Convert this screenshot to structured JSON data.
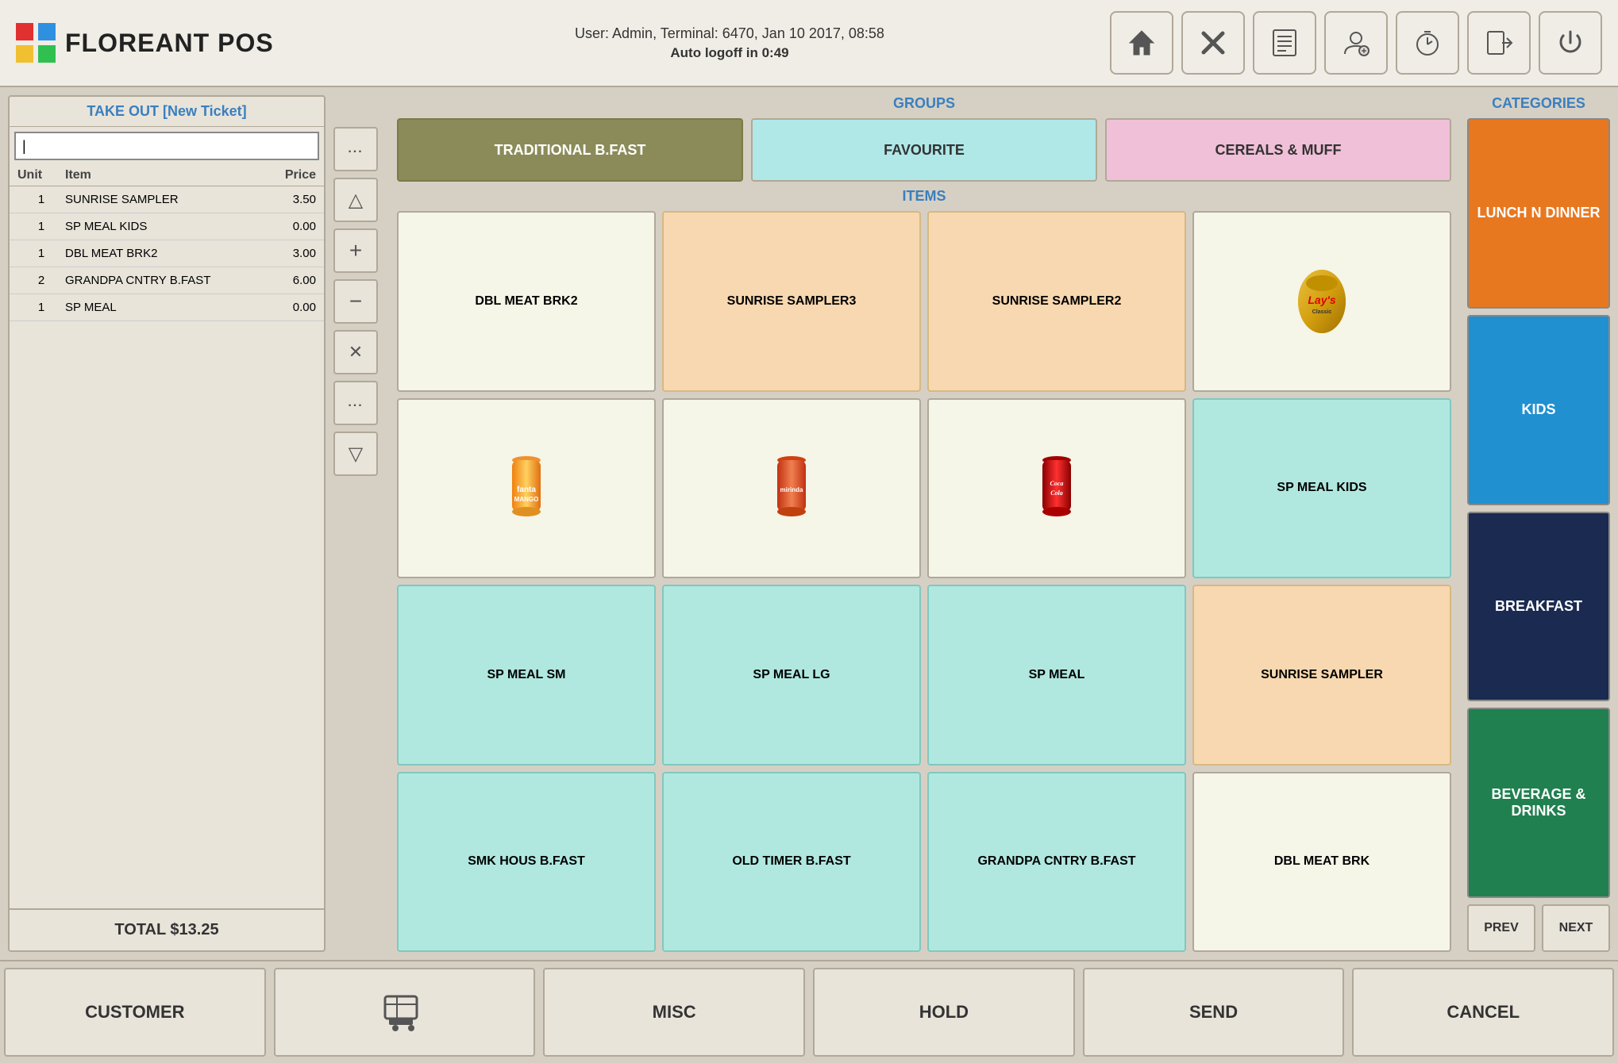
{
  "header": {
    "logo_text": "FLOREANT POS",
    "user_info": "User: Admin, Terminal: 6470, Jan 10 2017, 08:58",
    "auto_logoff": "Auto logoff in 0:49",
    "buttons": [
      {
        "name": "home",
        "icon": "🏠"
      },
      {
        "name": "settings",
        "icon": "⚙"
      },
      {
        "name": "reports",
        "icon": "📋"
      },
      {
        "name": "user",
        "icon": "👤"
      },
      {
        "name": "timer",
        "icon": "⏱"
      },
      {
        "name": "logout",
        "icon": "➡"
      },
      {
        "name": "power",
        "icon": "⏻"
      }
    ]
  },
  "ticket": {
    "title": "TAKE OUT [New Ticket]",
    "input_placeholder": "",
    "columns": {
      "unit": "Unit",
      "item": "Item",
      "price": "Price"
    },
    "rows": [
      {
        "unit": "1",
        "item": "SUNRISE SAMPLER",
        "price": "3.50"
      },
      {
        "unit": "1",
        "item": "SP MEAL KIDS",
        "price": "0.00"
      },
      {
        "unit": "1",
        "item": "DBL MEAT BRK2",
        "price": "3.00"
      },
      {
        "unit": "2",
        "item": "GRANDPA CNTRY B.FAST",
        "price": "6.00"
      },
      {
        "unit": "1",
        "item": "SP MEAL",
        "price": "0.00"
      }
    ],
    "total": "TOTAL $13.25"
  },
  "controls": {
    "dots_top": "...",
    "triangle_up": "△",
    "plus": "+",
    "minus": "−",
    "cross": "✕",
    "dots_bottom": "...",
    "triangle_down": "▽"
  },
  "groups": {
    "label": "GROUPS",
    "items": [
      {
        "label": "TRADITIONAL B.FAST",
        "style": "active"
      },
      {
        "label": "FAVOURITE",
        "style": "teal"
      },
      {
        "label": "CEREALS & MUFF",
        "style": "pink"
      }
    ]
  },
  "items": {
    "label": "ITEMS",
    "grid": [
      {
        "label": "DBL MEAT BRK2",
        "style": "default",
        "has_image": false
      },
      {
        "label": "SUNRISE SAMPLER3",
        "style": "salmon",
        "has_image": false
      },
      {
        "label": "SUNRISE SAMPLER2",
        "style": "salmon",
        "has_image": false
      },
      {
        "label": "LAYS",
        "style": "default",
        "has_image": true,
        "image_type": "lays"
      },
      {
        "label": "FANTA",
        "style": "default",
        "has_image": true,
        "image_type": "fanta"
      },
      {
        "label": "MIRINDA",
        "style": "default",
        "has_image": true,
        "image_type": "mirinda"
      },
      {
        "label": "COCA COLA",
        "style": "default",
        "has_image": true,
        "image_type": "cola"
      },
      {
        "label": "SP MEAL KIDS",
        "style": "teal",
        "has_image": false
      },
      {
        "label": "SP MEAL SM",
        "style": "teal",
        "has_image": false
      },
      {
        "label": "SP MEAL LG",
        "style": "teal",
        "has_image": false
      },
      {
        "label": "SP MEAL",
        "style": "teal",
        "has_image": false
      },
      {
        "label": "SUNRISE SAMPLER",
        "style": "salmon",
        "has_image": false
      },
      {
        "label": "SMK HOUS B.FAST",
        "style": "teal",
        "has_image": false
      },
      {
        "label": "OLD TIMER B.FAST",
        "style": "teal",
        "has_image": false
      },
      {
        "label": "GRANDPA CNTRY B.FAST",
        "style": "teal",
        "has_image": false
      },
      {
        "label": "DBL MEAT BRK",
        "style": "default",
        "has_image": false
      }
    ]
  },
  "categories": {
    "label": "CATEGORIES",
    "items": [
      {
        "label": "LUNCH N DINNER",
        "color": "orange"
      },
      {
        "label": "KIDS",
        "color": "blue"
      },
      {
        "label": "BREAKFAST",
        "color": "navy"
      },
      {
        "label": "BEVERAGE & DRINKS",
        "color": "green"
      }
    ],
    "prev": "PREV",
    "next": "NEXT"
  },
  "footer": {
    "buttons": [
      {
        "label": "CUSTOMER",
        "name": "customer"
      },
      {
        "label": "CART",
        "name": "cart",
        "is_icon": true
      },
      {
        "label": "MISC",
        "name": "misc"
      },
      {
        "label": "HOLD",
        "name": "hold"
      },
      {
        "label": "SEND",
        "name": "send"
      },
      {
        "label": "CANCEL",
        "name": "cancel"
      }
    ]
  }
}
